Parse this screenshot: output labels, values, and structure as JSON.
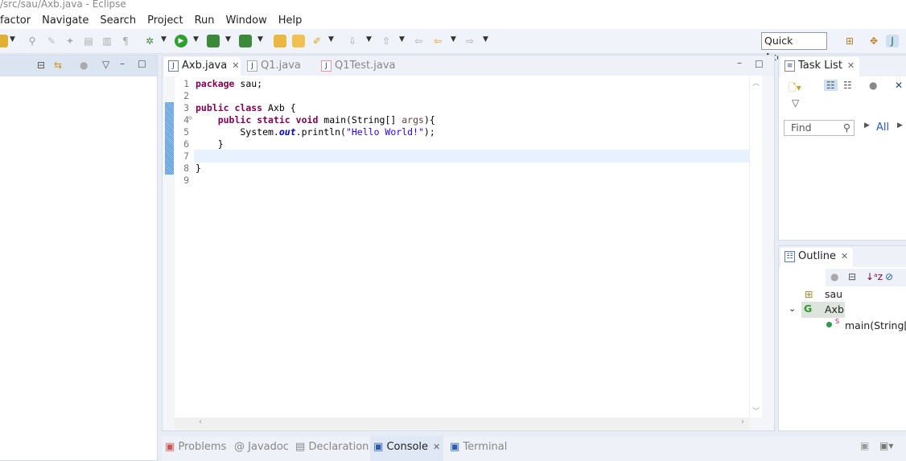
{
  "window": {
    "title": "/src/sau/Axb.java - Eclipse"
  },
  "menu": [
    "factor",
    "Navigate",
    "Search",
    "Project",
    "Run",
    "Window",
    "Help"
  ],
  "toolbar": {
    "quick_access": "Quick Access"
  },
  "editor": {
    "tabs": [
      {
        "label": "Axb.java",
        "active": true
      },
      {
        "label": "Q1.java"
      },
      {
        "label": "Q1Test.java"
      }
    ],
    "lines": [
      {
        "n": "1",
        "tokens": [
          {
            "t": "package",
            "c": "kw"
          },
          {
            "t": " sau;"
          }
        ]
      },
      {
        "n": "2",
        "tokens": []
      },
      {
        "n": "3",
        "tokens": [
          {
            "t": "public",
            "c": "kw"
          },
          {
            "t": " "
          },
          {
            "t": "class",
            "c": "kw"
          },
          {
            "t": " Axb {"
          }
        ]
      },
      {
        "n": "4",
        "tokens": [
          {
            "t": "    "
          },
          {
            "t": "public",
            "c": "kw"
          },
          {
            "t": " "
          },
          {
            "t": "static",
            "c": "kw"
          },
          {
            "t": " "
          },
          {
            "t": "void",
            "c": "kw"
          },
          {
            "t": " main(String[] "
          },
          {
            "t": "args",
            "c": "par"
          },
          {
            "t": "){"
          }
        ]
      },
      {
        "n": "5",
        "tokens": [
          {
            "t": "        System."
          },
          {
            "t": "out",
            "c": "fld"
          },
          {
            "t": ".println("
          },
          {
            "t": "\"Hello World!\"",
            "c": "str"
          },
          {
            "t": ");"
          }
        ]
      },
      {
        "n": "6",
        "tokens": [
          {
            "t": "    }"
          }
        ]
      },
      {
        "n": "7",
        "tokens": []
      },
      {
        "n": "8",
        "tokens": [
          {
            "t": "}"
          }
        ]
      },
      {
        "n": "9",
        "tokens": []
      }
    ],
    "current_line": "7"
  },
  "task_list": {
    "title": "Task List",
    "find_placeholder": "Find",
    "all_label": "All"
  },
  "outline": {
    "title": "Outline",
    "items": [
      {
        "label": "sau",
        "icon": "package-icon"
      },
      {
        "label": "Axb",
        "icon": "class-icon"
      },
      {
        "label": "main(String[])",
        "icon": "method-icon"
      }
    ],
    "static_marker": "S"
  },
  "bottom": {
    "tabs": [
      "Problems",
      "Javadoc",
      "Declaration",
      "Console",
      "Terminal"
    ],
    "active": "Console"
  }
}
